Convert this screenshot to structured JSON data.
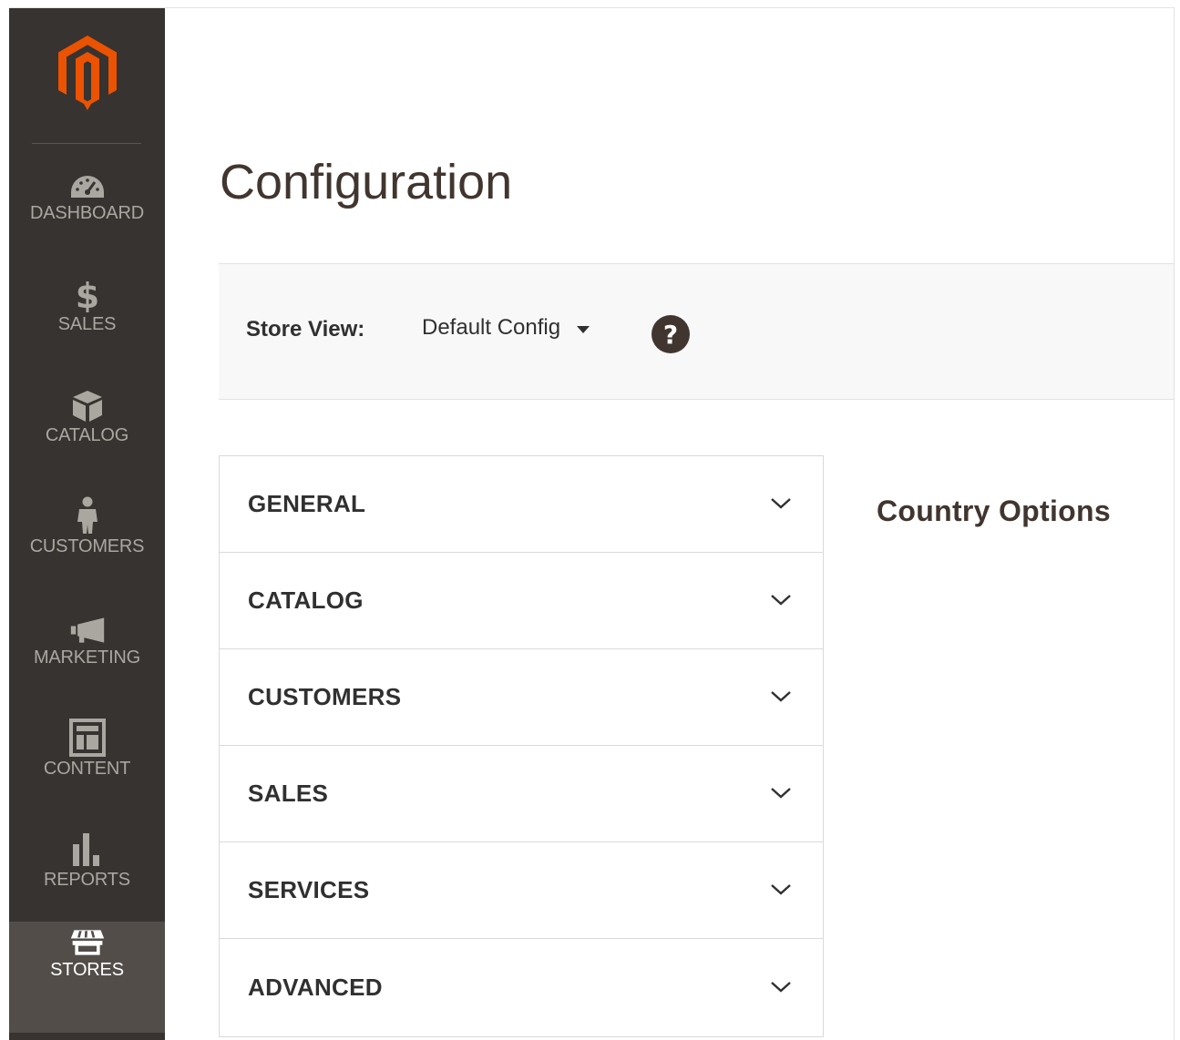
{
  "colors": {
    "sidebar_bg": "#373330",
    "sidebar_active_bg": "#524d49",
    "logo_orange": "#eb5202",
    "text_dark": "#303030",
    "title_color": "#41362f"
  },
  "sidebar": {
    "items": [
      {
        "label": "DASHBOARD",
        "icon": "dashboard-gauge-icon"
      },
      {
        "label": "SALES",
        "icon": "dollar-icon"
      },
      {
        "label": "CATALOG",
        "icon": "box-icon"
      },
      {
        "label": "CUSTOMERS",
        "icon": "person-icon"
      },
      {
        "label": "MARKETING",
        "icon": "megaphone-icon"
      },
      {
        "label": "CONTENT",
        "icon": "layout-icon"
      },
      {
        "label": "REPORTS",
        "icon": "bar-chart-icon"
      },
      {
        "label": "STORES",
        "icon": "storefront-icon",
        "active": true
      }
    ]
  },
  "main": {
    "title": "Configuration",
    "store_view": {
      "label": "Store View:",
      "selected": "Default Config"
    },
    "tabs": [
      {
        "label": "GENERAL"
      },
      {
        "label": "CATALOG"
      },
      {
        "label": "CUSTOMERS"
      },
      {
        "label": "SALES"
      },
      {
        "label": "SERVICES"
      },
      {
        "label": "ADVANCED"
      }
    ],
    "section_title": "Country Options"
  }
}
